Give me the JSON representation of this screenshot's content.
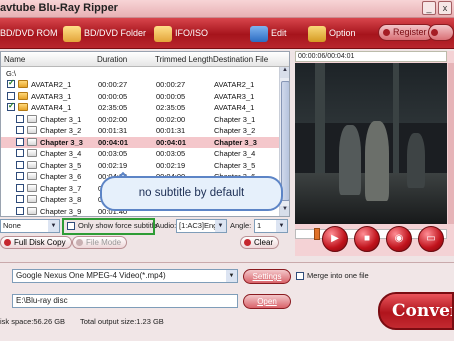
{
  "window": {
    "title": "avtube Blu-Ray Ripper",
    "min": "_",
    "close": "x"
  },
  "toolbar": {
    "bd_rom": "BD/DVD ROM",
    "bd_folder": "BD/DVD Folder",
    "ifo_iso": "IFO/ISO",
    "edit": "Edit",
    "option": "Option",
    "register": "Register",
    "help": "Help"
  },
  "grid": {
    "headers": [
      "Name",
      "Duration",
      "Trimmed Length",
      "Destination File"
    ],
    "root": "G:\\",
    "rows": [
      {
        "name": "AVATAR2_1",
        "duration": "00:00:27",
        "trimmed": "00:00:27",
        "dest": "AVATAR2_1"
      },
      {
        "name": "AVATAR3_1",
        "duration": "00:00:05",
        "trimmed": "00:00:05",
        "dest": "AVATAR3_1"
      },
      {
        "name": "AVATAR4_1",
        "duration": "02:35:05",
        "trimmed": "02:35:05",
        "dest": "AVATAR4_1"
      },
      {
        "name": "Chapter 3_1",
        "duration": "00:02:00",
        "trimmed": "00:02:00",
        "dest": "Chapter 3_1"
      },
      {
        "name": "Chapter 3_2",
        "duration": "00:01:31",
        "trimmed": "00:01:31",
        "dest": "Chapter 3_2"
      },
      {
        "name": "Chapter 3_3",
        "duration": "00:04:01",
        "trimmed": "00:04:01",
        "dest": "Chapter 3_3"
      },
      {
        "name": "Chapter 3_4",
        "duration": "00:03:05",
        "trimmed": "00:03:05",
        "dest": "Chapter 3_4"
      },
      {
        "name": "Chapter 3_5",
        "duration": "00:02:19",
        "trimmed": "00:02:19",
        "dest": "Chapter 3_5"
      },
      {
        "name": "Chapter 3_6",
        "duration": "00:04:00",
        "trimmed": "00:04:00",
        "dest": "Chapter 3_6"
      },
      {
        "name": "Chapter 3_7",
        "duration": "00:05:00",
        "trimmed": "",
        "dest": ""
      },
      {
        "name": "Chapter 3_8",
        "duration": "00:02:48",
        "trimmed": "",
        "dest": ""
      },
      {
        "name": "Chapter 3_9",
        "duration": "00:01:40",
        "trimmed": "",
        "dest": ""
      }
    ]
  },
  "callout": "no subtitle by default",
  "options": {
    "subtitle_value": "None",
    "force_subtitle_label": "Only show force subtitle",
    "audio_label": "Audio:",
    "audio_value": "[1:AC3]Engli",
    "angle_label": "Angle:",
    "angle_value": "1"
  },
  "actions": {
    "full_disk": "Full Disk Copy",
    "file_mode": "File Mode",
    "clear": "Clear"
  },
  "preview": {
    "time": "00:00:06/00:04:01"
  },
  "bottom": {
    "format_value": "Google Nexus One MPEG-4 Video(*.mp4)",
    "settings": "Settings",
    "merge_label": "Merge into one file",
    "output_value": "E:\\Blu-ray disc",
    "open": "Open",
    "space": "isk space:56.26 GB",
    "total": "Total output size:1.23 GB",
    "convert": "Conver"
  },
  "colors": {
    "accent": "#b0141c",
    "selected_row": "#f4c7cb",
    "callout_border": "#5c84c6",
    "green_highlight": "#2e9c35"
  }
}
